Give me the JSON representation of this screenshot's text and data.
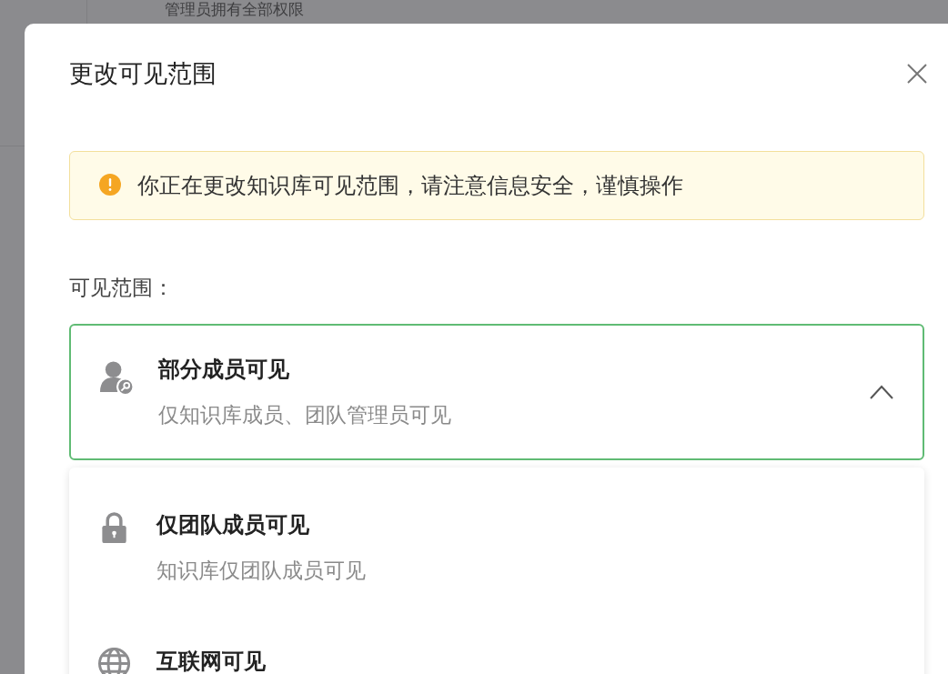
{
  "background": {
    "text": "管理员拥有全部权限"
  },
  "dialog": {
    "title": "更改可见范围",
    "alert": {
      "kind": "warning",
      "text": "你正在更改知识库可见范围，请注意信息安全，谨慎操作"
    },
    "field_label": "可见范围：",
    "select": {
      "kind": "member",
      "title": "部分成员可见",
      "description": "仅知识库成员、团队管理员可见",
      "expanded": true
    },
    "options": [
      {
        "kind": "lock",
        "title": "仅团队成员可见",
        "description": "知识库仅团队成员可见"
      },
      {
        "kind": "globe",
        "title": "互联网可见"
      }
    ]
  }
}
